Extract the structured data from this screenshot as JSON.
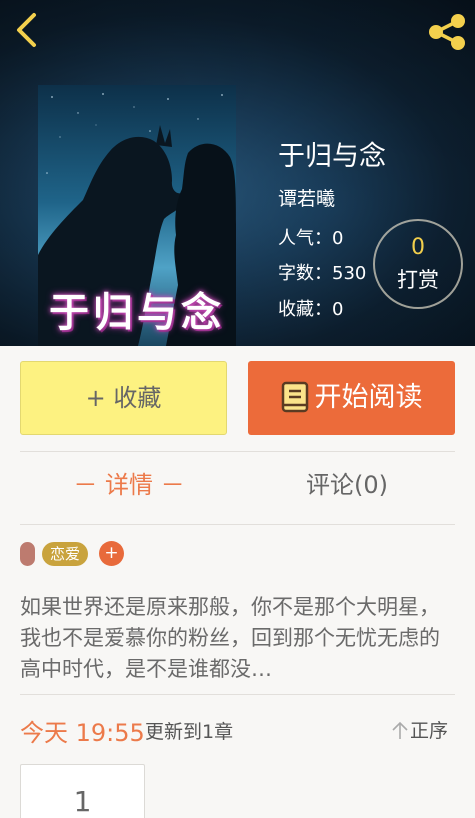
{
  "book": {
    "title": "于归与念",
    "cover_title": "于归与念",
    "author": "谭若曦",
    "popularity": "人气：0",
    "word_count": "字数：530",
    "favorites": "收藏：0"
  },
  "reward": {
    "count": "0",
    "label": "打赏"
  },
  "actions": {
    "favorite_label": "+ 收藏",
    "read_label": "开始阅读"
  },
  "tabs": {
    "detail": "－ 详情 －",
    "comments": "评论(0)"
  },
  "tags": {
    "items": [
      "恋爱"
    ],
    "add": "+"
  },
  "summary": "如果世界还是原来那般，你不是那个大明星，我也不是爱慕你的粉丝，回到那个无忧无虑的高中时代，是不是谁都没…",
  "update": {
    "time": "今天 19:55",
    "note": "更新到1章",
    "sort_label": "正序"
  },
  "chapters": [
    {
      "number": "1"
    }
  ],
  "icons": {
    "back": "chevron-left-icon",
    "share": "share-icon",
    "book": "book-icon",
    "sort": "arrow-up-icon"
  },
  "colors": {
    "accent": "#ec6b3a",
    "favorite_button": "#fdf281",
    "icon_yellow": "#f3d04d"
  }
}
